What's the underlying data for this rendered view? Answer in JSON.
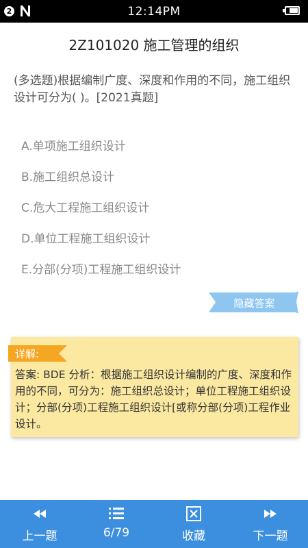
{
  "status_bar": {
    "notification_count": "2",
    "time": "12:14PM"
  },
  "header": {
    "title": "2Z101020 施工管理的组织"
  },
  "question": {
    "text": "(多选题)根据编制广度、深度和作用的不同，施工组织设计可分为( )。[2021真题]",
    "options": [
      "A.单项施工组织设计",
      "B.施工组织总设计",
      "C.危大工程施工组织设计",
      "D.单位工程施工组织设计",
      "E.分部(分项)工程施工组织设计"
    ]
  },
  "answer_toggle": {
    "label": "隐藏答案"
  },
  "explanation": {
    "tag": "详解:",
    "text": "答案: BDE 分析：根据施工组织设计编制的广度、深度和作用的不同，可分为：施工组织总设计；单位工程施工组织设计；分部(分项)工程施工组织设计[或称分部(分项)工程作业设计。"
  },
  "bottom_nav": {
    "prev_label": "上一题",
    "progress": "6/79",
    "favorite_label": "收藏",
    "next_label": "下一题"
  },
  "colors": {
    "nav_bar": "#3b8fde",
    "hide_button": "#8ec6f0",
    "explain_card": "#fbe9a2",
    "explain_tag": "#f5a623"
  }
}
